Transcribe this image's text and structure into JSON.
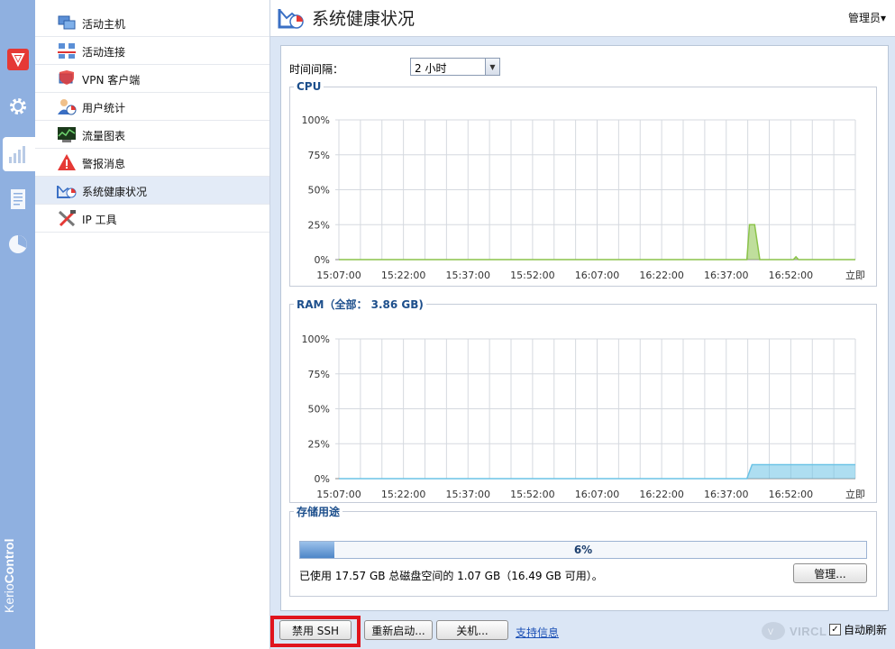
{
  "brand": {
    "part1": "Kerio",
    "part2": "Control"
  },
  "rail": {
    "items": [
      {
        "name": "security-icon"
      },
      {
        "name": "settings-icon"
      },
      {
        "name": "status-icon"
      },
      {
        "name": "logs-icon"
      },
      {
        "name": "reports-icon"
      }
    ]
  },
  "nav": {
    "items": [
      {
        "label": "活动主机",
        "icon": "active-hosts-icon"
      },
      {
        "label": "活动连接",
        "icon": "active-connections-icon"
      },
      {
        "label": "VPN 客户端",
        "icon": "vpn-clients-icon"
      },
      {
        "label": "用户统计",
        "icon": "user-statistics-icon"
      },
      {
        "label": "流量图表",
        "icon": "traffic-charts-icon"
      },
      {
        "label": "警报消息",
        "icon": "alert-messages-icon"
      },
      {
        "label": "系统健康状况",
        "icon": "system-health-icon"
      },
      {
        "label": "IP 工具",
        "icon": "ip-tools-icon"
      }
    ]
  },
  "header": {
    "title": "系统健康状况",
    "user_menu": "管理员▾"
  },
  "interval": {
    "label": "时间间隔：",
    "value": "2 小时"
  },
  "chart_data": [
    {
      "type": "area",
      "title": "CPU",
      "x_ticks": [
        "15:07:00",
        "15:22:00",
        "15:37:00",
        "15:52:00",
        "16:07:00",
        "16:22:00",
        "16:37:00",
        "16:52:00",
        "立即"
      ],
      "y_ticks": [
        "100%",
        "75%",
        "50%",
        "25%",
        "0%"
      ],
      "ylim": [
        0,
        100
      ],
      "grid": true,
      "color": "#8bc34a",
      "points": [
        [
          0,
          0
        ],
        [
          0.79,
          0
        ],
        [
          0.795,
          25
        ],
        [
          0.805,
          25
        ],
        [
          0.815,
          0
        ],
        [
          0.88,
          0
        ],
        [
          0.885,
          2
        ],
        [
          0.89,
          0
        ],
        [
          1,
          0
        ]
      ]
    },
    {
      "type": "area",
      "title": "RAM（全部： 3.86 GB)",
      "x_ticks": [
        "15:07:00",
        "15:22:00",
        "15:37:00",
        "15:52:00",
        "16:07:00",
        "16:22:00",
        "16:37:00",
        "16:52:00",
        "立即"
      ],
      "y_ticks": [
        "100%",
        "75%",
        "50%",
        "25%",
        "0%"
      ],
      "ylim": [
        0,
        100
      ],
      "grid": true,
      "color": "#6cc3e6",
      "points": [
        [
          0,
          0
        ],
        [
          0.79,
          0
        ],
        [
          0.8,
          10
        ],
        [
          1,
          10
        ]
      ]
    }
  ],
  "storage": {
    "title": "存储用途",
    "percent": 6,
    "percent_label": "6%",
    "text": "已使用 17.57 GB 总磁盘空间的 1.07 GB（16.49 GB 可用）。",
    "manage_label": "管理..."
  },
  "bottom": {
    "ssh_label": "禁用 SSH",
    "restart_label": "重新启动...",
    "shutdown_label": "关机...",
    "support_label": "支持信息",
    "auto_refresh_label": "自动刷新",
    "watermark": "VIRCL"
  }
}
